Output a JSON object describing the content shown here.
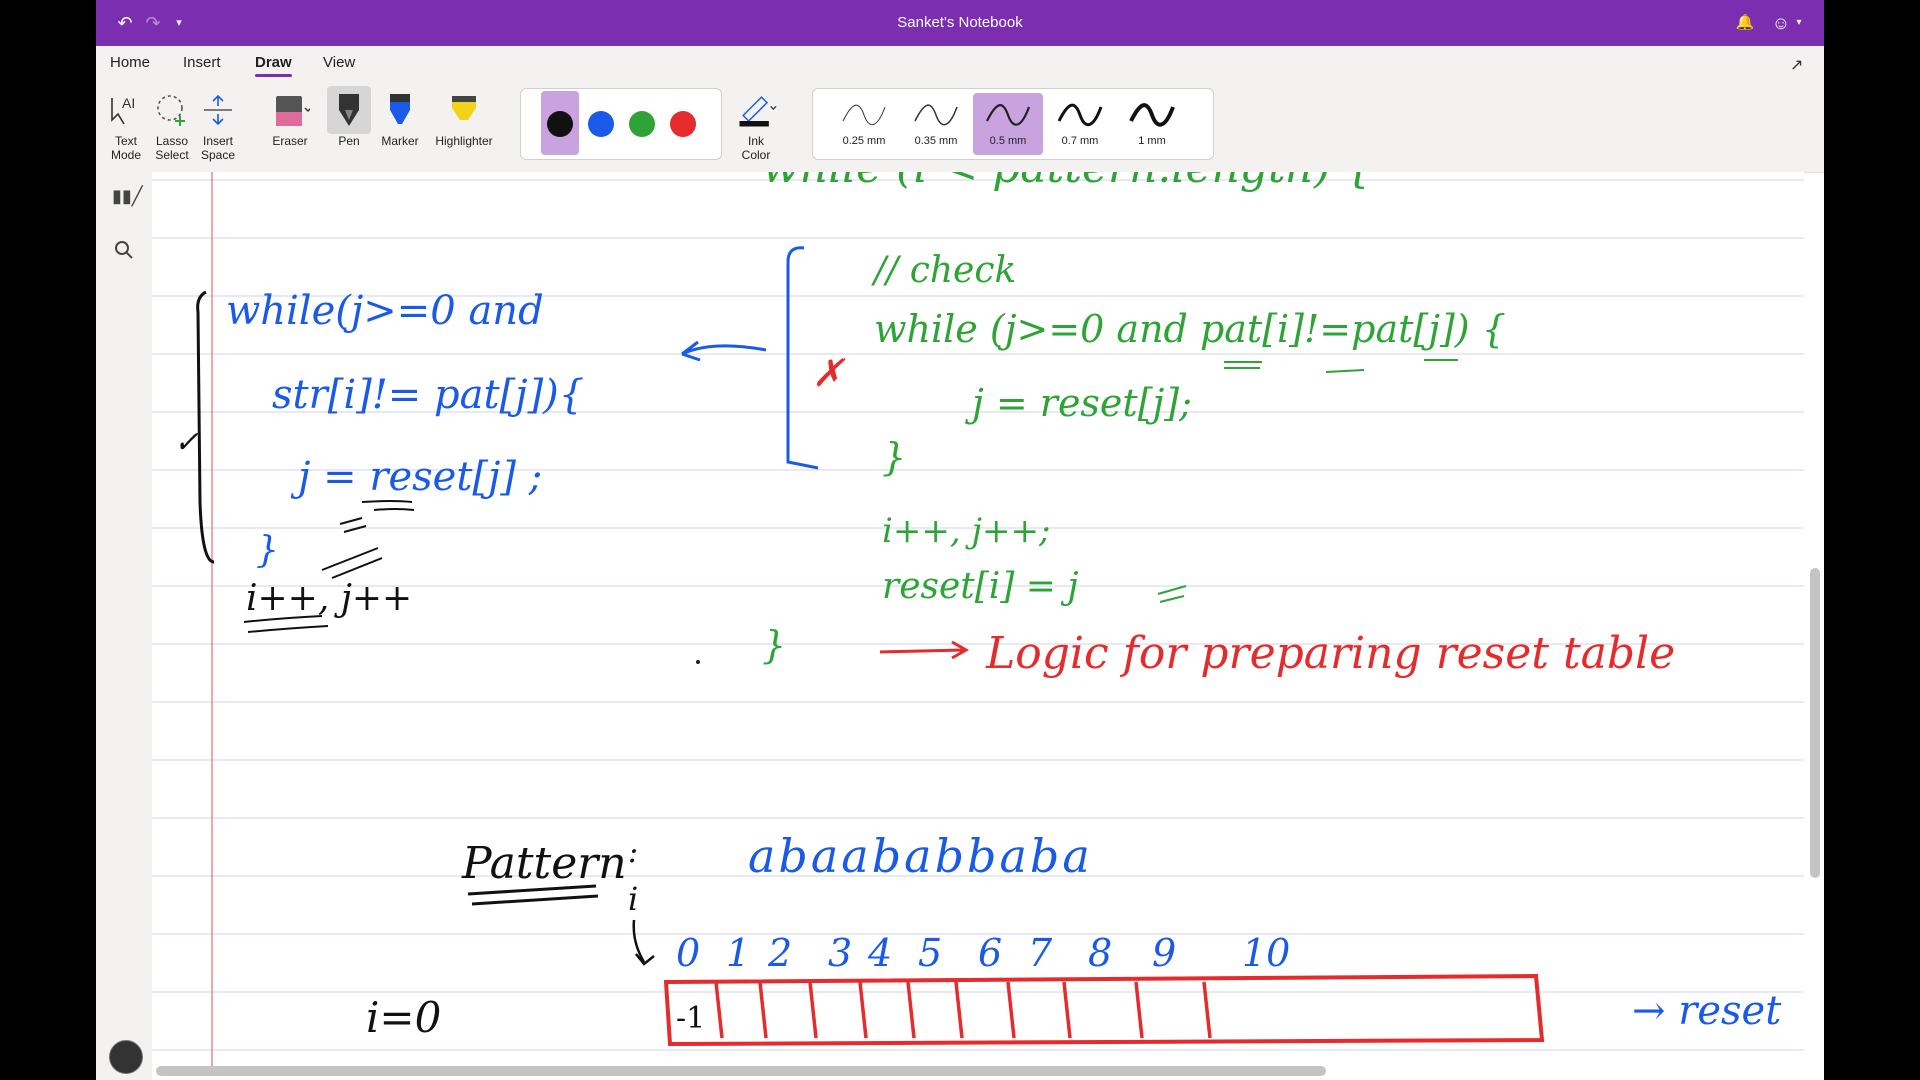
{
  "window": {
    "title": "Sanket's Notebook"
  },
  "titlebar_icons": {
    "undo": "undo-icon",
    "redo": "redo-icon",
    "more": "chevron-down-icon",
    "bell": "bell-icon",
    "account": "smiley-icon"
  },
  "ribbon": {
    "tabs": [
      {
        "label": "Home"
      },
      {
        "label": "Insert"
      },
      {
        "label": "Draw"
      },
      {
        "label": "View"
      }
    ],
    "active_tab": "Draw"
  },
  "toolbar": {
    "text_mode_line1": "Text",
    "text_mode_line2": "Mode",
    "lasso_line1": "Lasso",
    "lasso_line2": "Select",
    "insert_space_line1": "Insert",
    "insert_space_line2": "Space",
    "eraser": "Eraser",
    "pen": "Pen",
    "marker": "Marker",
    "highlighter": "Highlighter",
    "ink_color_line1": "Ink",
    "ink_color_line2": "Color",
    "colors": [
      "#111111",
      "#1a5ae8",
      "#2fa436",
      "#e52b2b"
    ],
    "thickness": [
      "0.25 mm",
      "0.35 mm",
      "0.5 mm",
      "0.7 mm",
      "1 mm"
    ],
    "selected_thickness": "0.5 mm"
  },
  "canvas": {
    "blue_code": [
      "while(j>=0 and",
      "str[i]!= pat[j]){",
      "j = reset[j] ;",
      "}"
    ],
    "black_notes": [
      "i++, j++"
    ],
    "green_code": [
      "wnile (i < pattern.length) {",
      "// check",
      "while (j>=0  and  pat[i]!=pat[j]) {",
      "j = reset[j];",
      "}",
      "i++, j++;",
      "reset[i] = j",
      "}"
    ],
    "red_note": "Logic for preparing reset table",
    "pattern_label": "Pattern",
    "pattern_string": "abaababbaba",
    "i_label": "i",
    "indices": [
      "0",
      "1",
      "2",
      "3",
      "4",
      "5",
      "6",
      "7",
      "8",
      "9",
      "10"
    ],
    "first_cell": "-1",
    "i_init": "i=0",
    "reset_label": "→ reset"
  }
}
